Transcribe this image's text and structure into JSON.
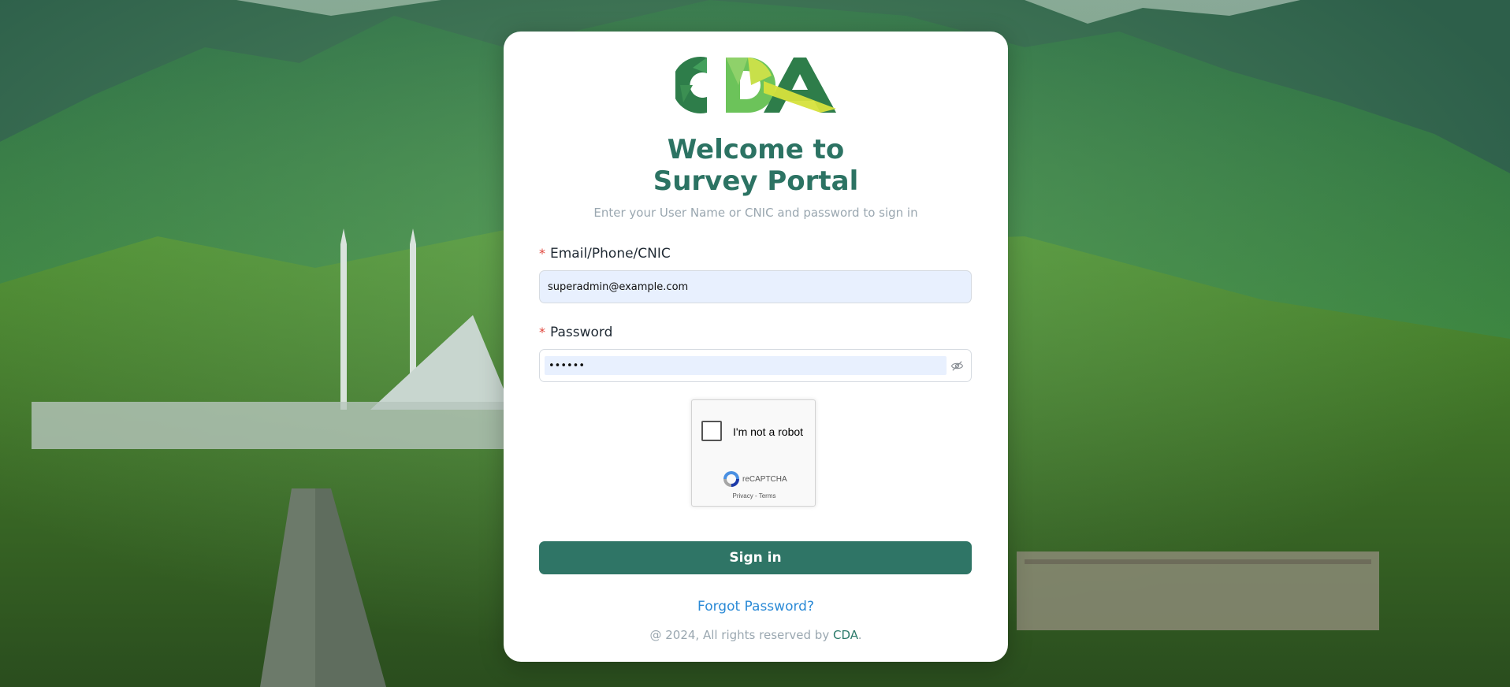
{
  "header": {
    "logo_text": "CDA",
    "title_line1": "Welcome to",
    "title_line2": "Survey Portal",
    "subtitle": "Enter your User Name or CNIC and password to sign in"
  },
  "form": {
    "email_required_mark": "*",
    "email_label": "Email/Phone/CNIC",
    "email_value": "superadmin@example.com",
    "password_required_mark": "*",
    "password_label": "Password",
    "password_value": "••••••",
    "password_toggle_icon": "eye-slash-icon"
  },
  "captcha": {
    "label": "I'm not a robot",
    "brand": "reCAPTCHA",
    "links": "Privacy - Terms",
    "checked": false
  },
  "actions": {
    "signin_label": "Sign in",
    "forgot_label": "Forgot Password?"
  },
  "footer": {
    "prefix": "@ 2024, All rights reserved by ",
    "brand": "CDA",
    "suffix": "."
  },
  "colors": {
    "primary": "#2f7566",
    "title": "#2c7363",
    "link": "#2b8ad6",
    "required": "#e0463c",
    "input_autofill": "#e8f0fe"
  }
}
